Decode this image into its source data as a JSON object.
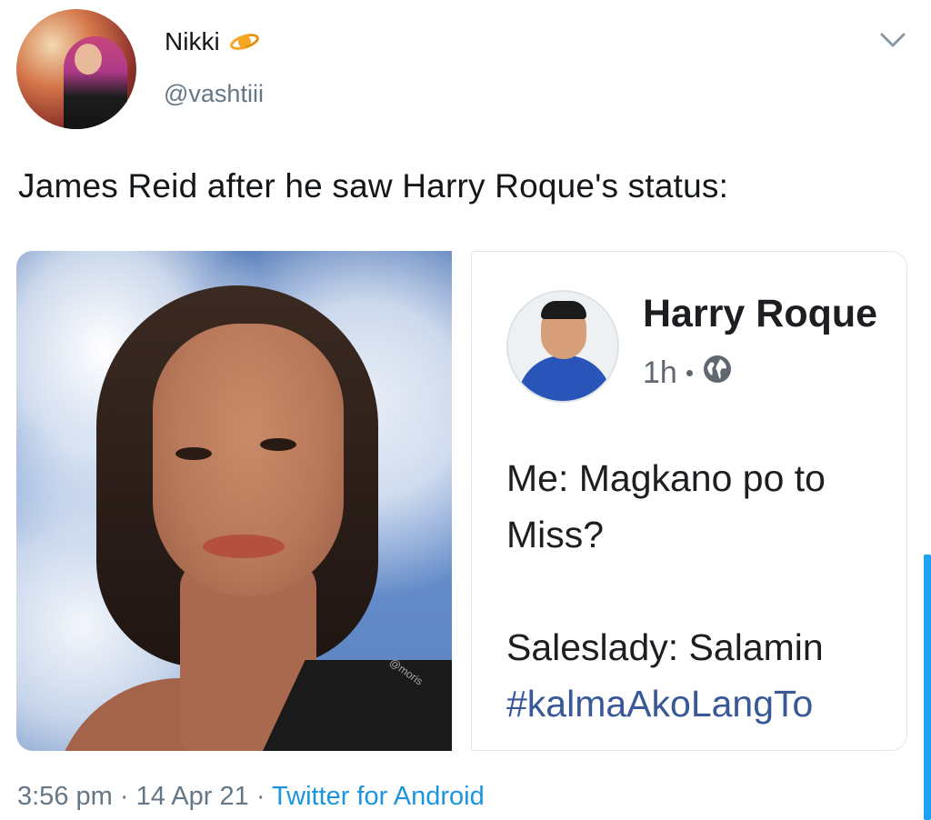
{
  "tweet": {
    "author_name": "Nikki",
    "author_handle": "@vashtiii",
    "badge_icon": "planet-icon",
    "text": "James Reid after he saw Harry Roque's status:",
    "time": "3:56 pm",
    "date": "14 Apr 21",
    "separator": "·",
    "source": "Twitter for Android"
  },
  "media": {
    "photo_watermark": "@moris",
    "fb_post": {
      "name": "Harry Roque",
      "time": "1h",
      "privacy_icon": "globe-icon",
      "line1": "Me: Magkano po to",
      "line2": "Miss?",
      "line3": "Saleslady: Salamin",
      "hashtag": "#kalmaAkoLangTo"
    }
  },
  "colors": {
    "handle": "#657786",
    "link": "#1b95e0",
    "hashtag": "#385898",
    "badge": "#f5a623"
  }
}
